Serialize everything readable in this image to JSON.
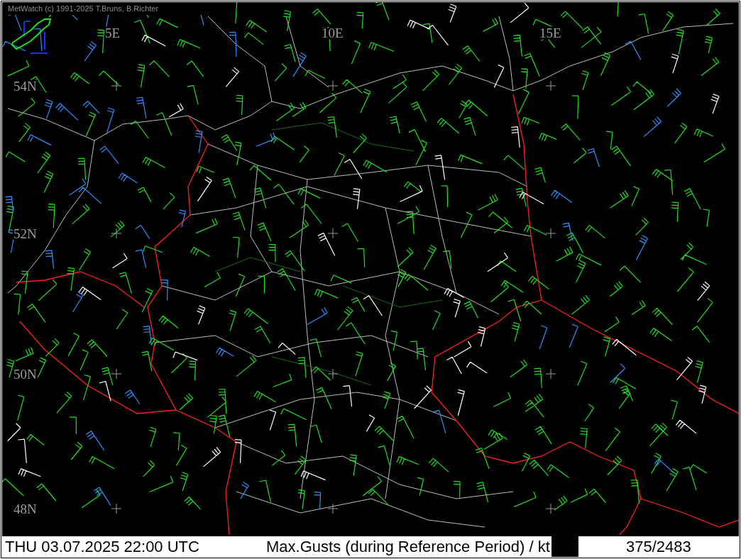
{
  "header": {
    "credit": "MetWatch  (c) 1991-2025 T.Bruns, B.Richter"
  },
  "map": {
    "longitude_labels": [
      "5E",
      "10E",
      "15E"
    ],
    "latitude_labels": [
      "54N",
      "52N",
      "50N",
      "48N"
    ]
  },
  "status_bar": {
    "datetime": "THU 03.07.2025 22:00 UTC",
    "title": "Max.Gusts (during Reference Period) / kt",
    "counter": "375/2483"
  }
}
